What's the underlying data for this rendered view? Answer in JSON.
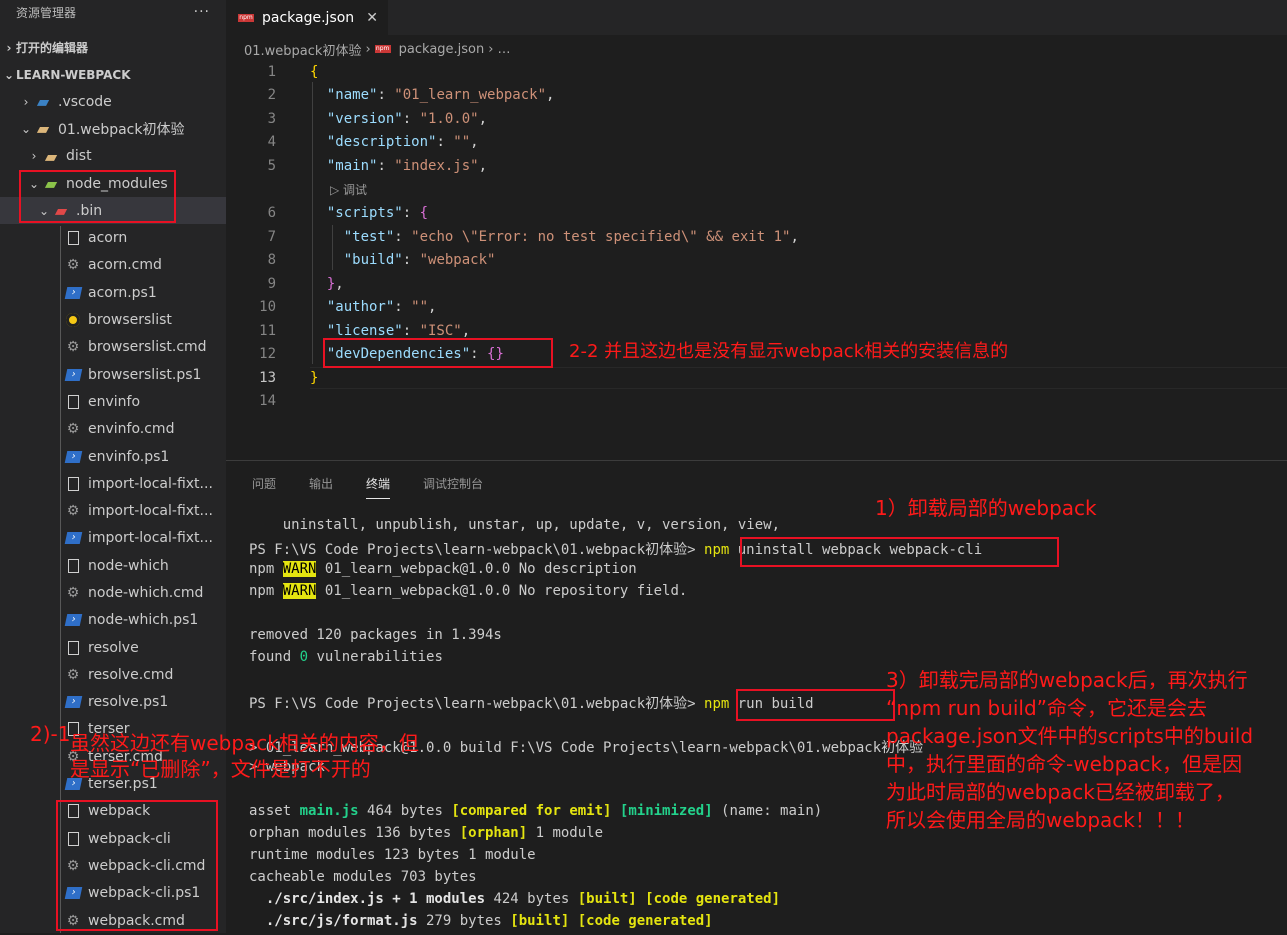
{
  "sidebar": {
    "header": "资源管理器",
    "more": "···",
    "open_editors": "打开的编辑器",
    "project": "LEARN-WEBPACK",
    "items": [
      {
        "label": ".vscode",
        "chev": "›",
        "icon": "vscode-folder-icon"
      },
      {
        "label": "01.webpack初体验",
        "chev": "⌄",
        "icon": "folder-open-icon"
      },
      {
        "label": "dist",
        "chev": "›",
        "icon": "folder-icon"
      },
      {
        "label": "node_modules",
        "chev": "⌄",
        "icon": "node-folder-icon"
      },
      {
        "label": ".bin",
        "chev": "⌄",
        "icon": "bin-folder-icon"
      },
      {
        "label": "acorn",
        "icon": "file-icon"
      },
      {
        "label": "acorn.cmd",
        "icon": "gear-icon"
      },
      {
        "label": "acorn.ps1",
        "icon": "powershell-icon"
      },
      {
        "label": "browserslist",
        "icon": "browserslist-icon"
      },
      {
        "label": "browserslist.cmd",
        "icon": "gear-icon"
      },
      {
        "label": "browserslist.ps1",
        "icon": "powershell-icon"
      },
      {
        "label": "envinfo",
        "icon": "file-icon"
      },
      {
        "label": "envinfo.cmd",
        "icon": "gear-icon"
      },
      {
        "label": "envinfo.ps1",
        "icon": "powershell-icon"
      },
      {
        "label": "import-local-fixt...",
        "icon": "file-icon"
      },
      {
        "label": "import-local-fixt...",
        "icon": "gear-icon"
      },
      {
        "label": "import-local-fixt...",
        "icon": "powershell-icon"
      },
      {
        "label": "node-which",
        "icon": "file-icon"
      },
      {
        "label": "node-which.cmd",
        "icon": "gear-icon"
      },
      {
        "label": "node-which.ps1",
        "icon": "powershell-icon"
      },
      {
        "label": "resolve",
        "icon": "file-icon"
      },
      {
        "label": "resolve.cmd",
        "icon": "gear-icon"
      },
      {
        "label": "resolve.ps1",
        "icon": "powershell-icon"
      },
      {
        "label": "terser",
        "icon": "file-icon"
      },
      {
        "label": "terser.cmd",
        "icon": "gear-icon"
      },
      {
        "label": "terser.ps1",
        "icon": "powershell-icon"
      },
      {
        "label": "webpack",
        "icon": "file-icon"
      },
      {
        "label": "webpack-cli",
        "icon": "file-icon"
      },
      {
        "label": "webpack-cli.cmd",
        "icon": "gear-icon"
      },
      {
        "label": "webpack-cli.ps1",
        "icon": "powershell-icon"
      },
      {
        "label": "webpack.cmd",
        "icon": "gear-icon"
      }
    ]
  },
  "tab": {
    "label": "package.json",
    "close": "✕",
    "npm": "npm"
  },
  "breadcrumb": {
    "folder": "01.webpack初体验",
    "sep": "›",
    "file": "package.json",
    "tail": "…"
  },
  "editor": {
    "line_numbers": [
      "1",
      "2",
      "3",
      "4",
      "5",
      "6",
      "7",
      "8",
      "9",
      "10",
      "11",
      "12",
      "13",
      "14"
    ],
    "current_line": "13",
    "codelens": "调试",
    "codelens_icon": "play-icon"
  },
  "panel": {
    "tabs": [
      "问题",
      "输出",
      "终端",
      "调试控制台"
    ],
    "active_tab": "终端",
    "terminal": {
      "l1": "    uninstall, unpublish, unstar, up, update, v, version, view,",
      "prompt": "PS F:\\VS Code Projects\\learn-webpack\\01.webpack初体验> ",
      "cmd1_npm": "npm",
      "cmd1_rest": " uninstall webpack webpack-cli",
      "npm": "npm ",
      "warn": "WARN",
      "w1": " 01_learn_webpack@1.0.0 No description",
      "w2": " 01_learn_webpack@1.0.0 No repository field.",
      "removed": "removed 120 packages in 1.394s",
      "found_a": "found ",
      "found_n": "0",
      "found_b": " vulnerabilities",
      "cmd2_npm": "npm",
      "cmd2_rest": " run build",
      "run1": "> 01_learn_webpack@1.0.0 build F:\\VS Code Projects\\learn-webpack\\01.webpack初体验",
      "run2": "> webpack",
      "asset_a": "asset ",
      "asset_file": "main.js",
      "asset_b": " 464 bytes ",
      "asset_cmp": "[compared for emit]",
      "asset_min": "[minimized]",
      "asset_c": " (name: main)",
      "orphan_a": "orphan modules 136 bytes ",
      "orphan_b": "[orphan]",
      "orphan_c": " 1 module",
      "runtime": "runtime modules 123 bytes 1 module",
      "cacheable": "cacheable modules 703 bytes",
      "src1_a": "  ./src/index.js + 1 modules",
      "src1_b": " 424 bytes ",
      "src1_c": "[built] [code generated]",
      "src2_a": "  ./src/js/format.js",
      "src2_b": " 279 bytes ",
      "src2_c": "[built] [code generated]"
    }
  },
  "annotations": {
    "n1": "1）卸载局部的webpack",
    "n22": "2-2 并且这边也是没有显示webpack相关的安装信息的",
    "n21_prefix": "2)-1",
    "n21": "虽然这边还有webpack相关的内容，但\n是显示“已删除”，文件是打不开的",
    "n3": "3）卸载完局部的webpack后，再次执行\n“npm run build”命令，它还是会去\npackage.json文件中的scripts中的build\n中，执行里面的命令-webpack，但是因\n为此时局部的webpack已经被卸载了，\n所以会使用全局的webpack！！！"
  },
  "colors": {
    "accent_red": "#e81123",
    "npm_red": "#cb3837"
  }
}
